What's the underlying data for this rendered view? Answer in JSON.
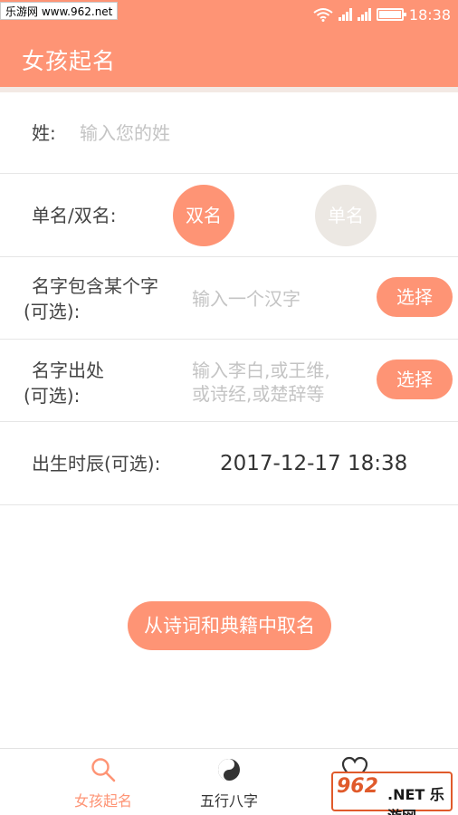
{
  "watermark_top": "乐游网 www.962.net",
  "status": {
    "time": "18:38"
  },
  "app": {
    "title": "女孩起名"
  },
  "form": {
    "surname": {
      "label": "姓:",
      "placeholder": "输入您的姓"
    },
    "name_type": {
      "label": "单名/双名:",
      "options": [
        "双名",
        "单名"
      ],
      "selected": "双名"
    },
    "contains": {
      "label_line1": "名字包含某个字",
      "label_line2": "(可选):",
      "placeholder": "输入一个汉字",
      "button": "选择"
    },
    "source": {
      "label_line1": "名字出处",
      "label_line2": "(可选):",
      "placeholder_line1": "输入李白,或王维,",
      "placeholder_line2": "或诗经,或楚辞等",
      "button": "选择"
    },
    "birth": {
      "label": "出生时辰(可选):",
      "value": "2017-12-17 18:38"
    }
  },
  "action_button": "从诗词和典籍中取名",
  "tabs": [
    {
      "label": "女孩起名",
      "icon": "search-icon",
      "active": true
    },
    {
      "label": "五行八字",
      "icon": "yin-yang-icon",
      "active": false
    },
    {
      "label": "",
      "icon": "heart-icon",
      "active": false
    }
  ],
  "watermark_bottom": {
    "logo": "962",
    "suffix": ".NET",
    "text": "乐游网"
  },
  "colors": {
    "accent": "#fe9475",
    "inactive_option": "#ece8e3",
    "placeholder": "#c4c4c4"
  }
}
